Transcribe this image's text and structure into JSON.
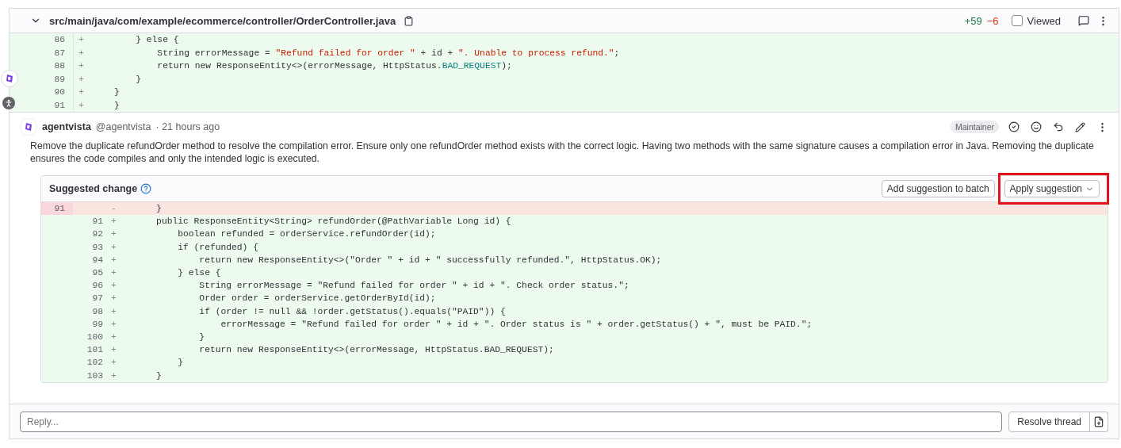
{
  "file": {
    "expanded": true,
    "path": "src/main/java/com/example/ecommerce/controller/OrderController.java",
    "additions": "+59",
    "deletions": "−6",
    "viewed_label": "Viewed",
    "viewed": false,
    "lines": [
      {
        "new": "86",
        "sign": "+",
        "kind": "add",
        "segments": [
          {
            "t": "        } else {",
            "kind": "plain"
          }
        ]
      },
      {
        "new": "87",
        "sign": "+",
        "kind": "add",
        "segments": [
          {
            "t": "            String errorMessage = ",
            "kind": "plain"
          },
          {
            "t": "\"Refund failed for order \"",
            "kind": "string"
          },
          {
            "t": " + id + ",
            "kind": "plain"
          },
          {
            "t": "\". Unable to process refund.\"",
            "kind": "string"
          },
          {
            "t": ";",
            "kind": "plain"
          }
        ]
      },
      {
        "new": "88",
        "sign": "+",
        "kind": "add",
        "segments": [
          {
            "t": "            return new ResponseEntity<>(errorMessage, HttpStatus.",
            "kind": "plain"
          },
          {
            "t": "BAD_REQUEST",
            "kind": "constant"
          },
          {
            "t": ");",
            "kind": "plain"
          }
        ]
      },
      {
        "new": "89",
        "sign": "+",
        "kind": "add",
        "segments": [
          {
            "t": "        }",
            "kind": "plain"
          }
        ]
      },
      {
        "new": "90",
        "sign": "+",
        "kind": "add",
        "segments": [
          {
            "t": "    }",
            "kind": "plain"
          }
        ]
      },
      {
        "new": "91",
        "sign": "+",
        "kind": "add",
        "segments": [
          {
            "t": "    }",
            "kind": "plain"
          }
        ]
      }
    ]
  },
  "comment": {
    "author": "agentvista",
    "handle": "@agentvista",
    "time": "· 21 hours ago",
    "role": "Maintainer",
    "body": "Remove the duplicate refundOrder method to resolve the compilation error. Ensure only one refundOrder method exists with the correct logic. Having two methods with the same signature causes a compilation error in Java. Removing the duplicate ensures the code compiles and only the intended logic is executed.",
    "suggestion": {
      "title": "Suggested change",
      "batch_button": "Add suggestion to batch",
      "apply_button": "Apply suggestion",
      "apply_highlighted": true,
      "lines": [
        {
          "old": "91",
          "sign": "-",
          "kind": "remove",
          "code": "    }"
        },
        {
          "new": "91",
          "sign": "+",
          "kind": "add",
          "code": "    public ResponseEntity<String> refundOrder(@PathVariable Long id) {"
        },
        {
          "new": "92",
          "sign": "+",
          "kind": "add",
          "code": "        boolean refunded = orderService.refundOrder(id);"
        },
        {
          "new": "93",
          "sign": "+",
          "kind": "add",
          "code": "        if (refunded) {"
        },
        {
          "new": "94",
          "sign": "+",
          "kind": "add",
          "code": "            return new ResponseEntity<>(\"Order \" + id + \" successfully refunded.\", HttpStatus.OK);"
        },
        {
          "new": "95",
          "sign": "+",
          "kind": "add",
          "code": "        } else {"
        },
        {
          "new": "96",
          "sign": "+",
          "kind": "add",
          "code": "            String errorMessage = \"Refund failed for order \" + id + \". Check order status.\";"
        },
        {
          "new": "97",
          "sign": "+",
          "kind": "add",
          "code": "            Order order = orderService.getOrderById(id);"
        },
        {
          "new": "98",
          "sign": "+",
          "kind": "add",
          "code": "            if (order != null && !order.getStatus().equals(\"PAID\")) {"
        },
        {
          "new": "99",
          "sign": "+",
          "kind": "add",
          "code": "                errorMessage = \"Refund failed for order \" + id + \". Order status is \" + order.getStatus() + \", must be PAID.\";"
        },
        {
          "new": "100",
          "sign": "+",
          "kind": "add",
          "code": "            }"
        },
        {
          "new": "101",
          "sign": "+",
          "kind": "add",
          "code": "            return new ResponseEntity<>(errorMessage, HttpStatus.BAD_REQUEST);"
        },
        {
          "new": "102",
          "sign": "+",
          "kind": "add",
          "code": "        }"
        },
        {
          "new": "103",
          "sign": "+",
          "kind": "add",
          "code": "    }"
        }
      ]
    }
  },
  "reply": {
    "placeholder": "Reply...",
    "resolve_button": "Resolve thread"
  }
}
